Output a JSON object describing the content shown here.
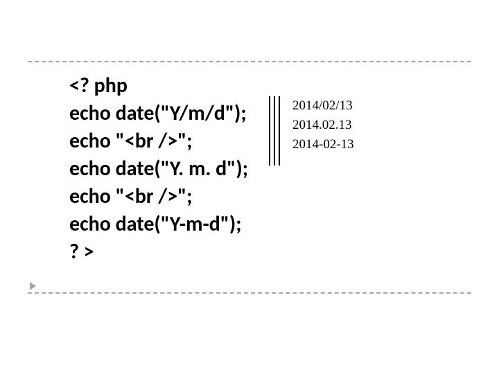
{
  "code": {
    "lines": [
      "<? php",
      "echo date(\"Y/m/d\");",
      "echo \"<br />\";",
      "echo date(\"Y. m. d\");",
      "echo \"<br />\";",
      "echo date(\"Y-m-d\");",
      "? >"
    ]
  },
  "output": {
    "lines": [
      "2014/02/13",
      "2014.02.13",
      "2014-02-13"
    ]
  }
}
